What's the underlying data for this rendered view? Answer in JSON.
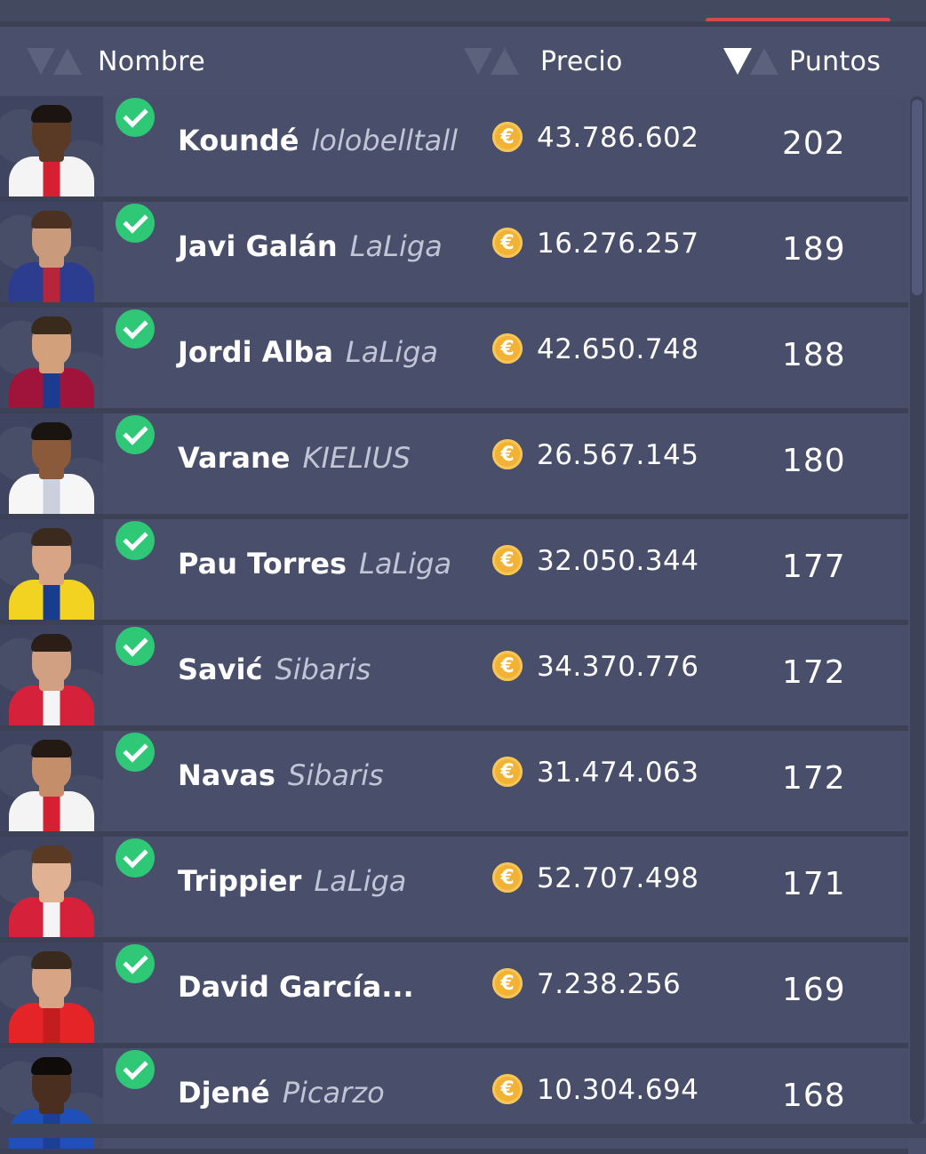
{
  "tabs": {
    "active_index": 1
  },
  "header": {
    "name_label": "Nombre",
    "price_label": "Precio",
    "points_label": "Puntos",
    "active_sort": "points-descending"
  },
  "currency_symbol": "€",
  "colors": {
    "background": "#4a506b",
    "accent": "#d8494e",
    "check": "#2ec877",
    "coin": "#f2b233"
  },
  "players": [
    {
      "name": "Koundé",
      "owner": "lolobelltall",
      "price": "43.786.602",
      "points": "202",
      "shirt": "#f4f4f4",
      "trim": "#d62031",
      "skin": "#5a3a25",
      "hair": "#1c1410"
    },
    {
      "name": "Javi Galán",
      "owner": "LaLiga",
      "price": "16.276.257",
      "points": "189",
      "shirt": "#2c3d8f",
      "trim": "#b7253a",
      "skin": "#c99a7c",
      "hair": "#4a3122"
    },
    {
      "name": "Jordi Alba",
      "owner": "LaLiga",
      "price": "42.650.748",
      "points": "188",
      "shirt": "#a0133a",
      "trim": "#1b3b8f",
      "skin": "#d2a07a",
      "hair": "#3a2a1c"
    },
    {
      "name": "Varane",
      "owner": "KIELIUS",
      "price": "26.567.145",
      "points": "180",
      "shirt": "#f6f6f6",
      "trim": "#cbd0dc",
      "skin": "#8a5a3a",
      "hair": "#1a1410"
    },
    {
      "name": "Pau Torres",
      "owner": "LaLiga",
      "price": "32.050.344",
      "points": "177",
      "shirt": "#f3d321",
      "trim": "#1a3c8e",
      "skin": "#d7a585",
      "hair": "#3b2a1e"
    },
    {
      "name": "Savić",
      "owner": "Sibaris",
      "price": "34.370.776",
      "points": "172",
      "shirt": "#d5213a",
      "trim": "#f4f4f4",
      "skin": "#d1a083",
      "hair": "#2a1e16"
    },
    {
      "name": "Navas",
      "owner": "Sibaris",
      "price": "31.474.063",
      "points": "172",
      "shirt": "#f4f4f4",
      "trim": "#d62031",
      "skin": "#c58e6b",
      "hair": "#231a14"
    },
    {
      "name": "Trippier",
      "owner": "LaLiga",
      "price": "52.707.498",
      "points": "171",
      "shirt": "#d5213a",
      "trim": "#f4f4f4",
      "skin": "#e0b193",
      "hair": "#5a3a22"
    },
    {
      "name": "David García...",
      "owner": "",
      "price": "7.238.256",
      "points": "169",
      "shirt": "#e42426",
      "trim": "#c31d20",
      "skin": "#d7a585",
      "hair": "#3a2a1e"
    },
    {
      "name": "Djené",
      "owner": "Picarzo",
      "price": "10.304.694",
      "points": "168",
      "shirt": "#1f4fb8",
      "trim": "#1a3f93",
      "skin": "#4a2f20",
      "hair": "#0f0b08"
    }
  ]
}
